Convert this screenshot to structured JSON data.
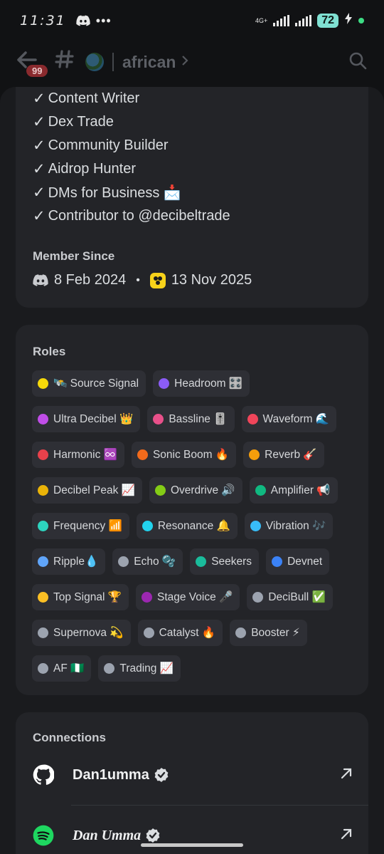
{
  "status_bar": {
    "time": "11:31",
    "dots": "•••",
    "network": "4G+",
    "battery": "72"
  },
  "header": {
    "unread_badge": "99",
    "channel_name": "african"
  },
  "about": {
    "lines": [
      "Content Writer",
      "Dex Trade",
      "Community Builder",
      "Aidrop Hunter",
      "DMs for Business 📩",
      "Contributor to @decibeltrade"
    ]
  },
  "member_since": {
    "title": "Member Since",
    "discord_date": "8 Feb 2024",
    "separator": "•",
    "server_date": "13 Nov 2025"
  },
  "roles": {
    "title": "Roles",
    "items": [
      {
        "label": "🛰️ Source Signal",
        "color": "#f5d90a"
      },
      {
        "label": "Headroom 🎛️",
        "color": "#8b5cf6"
      },
      {
        "label": "Ultra Decibel 👑",
        "color": "#c04de8"
      },
      {
        "label": "Bassline 🎚️",
        "color": "#e8508a"
      },
      {
        "label": "Waveform 🌊",
        "color": "#f0455a"
      },
      {
        "label": "Harmonic ♾️",
        "color": "#e8414b"
      },
      {
        "label": "Sonic Boom 🔥",
        "color": "#f26a1b"
      },
      {
        "label": "Reverb 🎸",
        "color": "#f59e0b"
      },
      {
        "label": "Decibel Peak 📈",
        "color": "#eab308"
      },
      {
        "label": "Overdrive 🔊",
        "color": "#84cc16"
      },
      {
        "label": "Amplifier 📢",
        "color": "#10b981"
      },
      {
        "label": "Frequency 📶",
        "color": "#2dd4bf"
      },
      {
        "label": "Resonance 🔔",
        "color": "#22d3ee"
      },
      {
        "label": "Vibration 🎶",
        "color": "#38bdf8"
      },
      {
        "label": "Ripple💧",
        "color": "#60a5fa"
      },
      {
        "label": "Echo 🫧",
        "color": "#9ca3af"
      },
      {
        "label": "Seekers",
        "color": "#1abc9c"
      },
      {
        "label": "Devnet",
        "color": "#3b82f6"
      },
      {
        "label": "Top Signal 🏆",
        "color": "#fbbf24"
      },
      {
        "label": "Stage Voice 🎤",
        "color": "#9b27b0"
      },
      {
        "label": "DeciBull ✅",
        "color": "#9ca3af"
      },
      {
        "label": "Supernova 💫",
        "color": "#9ca3af"
      },
      {
        "label": "Catalyst 🔥",
        "color": "#9ca3af"
      },
      {
        "label": "Booster ⚡",
        "color": "#9ca3af"
      },
      {
        "label": "AF 🇳🇬",
        "color": "#9ca3af"
      },
      {
        "label": "Trading 📈",
        "color": "#9ca3af"
      }
    ]
  },
  "connections": {
    "title": "Connections",
    "items": [
      {
        "service": "github-icon",
        "name": "Dan1umma"
      },
      {
        "service": "spotify-icon",
        "name": "Dan Umma"
      }
    ]
  },
  "colors": {
    "background": "#111214",
    "sheet": "#1a1b1e",
    "card": "#232428",
    "role_pill": "#2e2f35",
    "spotify": "#1ed760",
    "server_icon": "#f7d21a"
  }
}
